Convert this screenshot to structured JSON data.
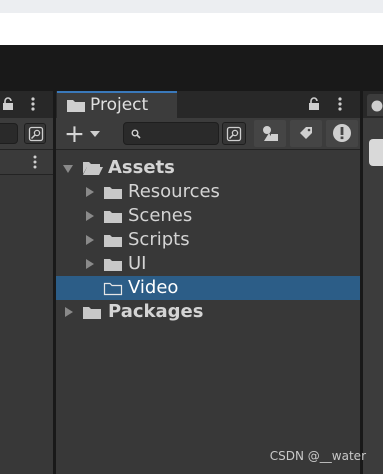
{
  "project_panel": {
    "tab_label": "Project",
    "add_symbol": "+",
    "search": {
      "placeholder": "",
      "icon": "search-icon"
    },
    "tree": [
      {
        "label": "Assets",
        "level": 0,
        "expanded": true,
        "bold": true,
        "has_children": true
      },
      {
        "label": "Resources",
        "level": 1,
        "expanded": false,
        "bold": false,
        "has_children": true
      },
      {
        "label": "Scenes",
        "level": 1,
        "expanded": false,
        "bold": false,
        "has_children": true
      },
      {
        "label": "Scripts",
        "level": 1,
        "expanded": false,
        "bold": false,
        "has_children": true
      },
      {
        "label": "UI",
        "level": 1,
        "expanded": false,
        "bold": false,
        "has_children": true
      },
      {
        "label": "Video",
        "level": 1,
        "expanded": false,
        "bold": false,
        "has_children": false,
        "selected": true
      },
      {
        "label": "Packages",
        "level": 0,
        "expanded": false,
        "bold": true,
        "has_children": true
      }
    ]
  },
  "watermark": "CSDN @__water",
  "colors": {
    "selection": "#2c5d87",
    "tab_accent": "#3a79bb"
  }
}
